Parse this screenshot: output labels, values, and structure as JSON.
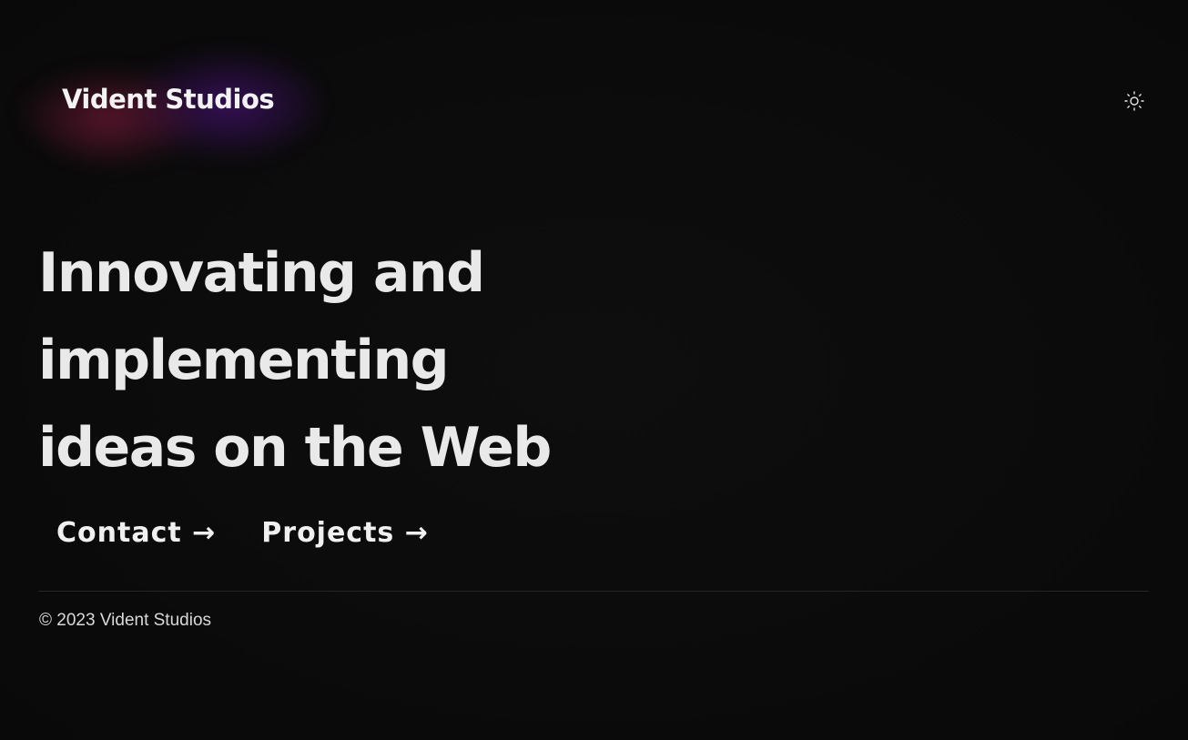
{
  "header": {
    "logo": "Vident Studios",
    "theme_toggle_icon": "sun-icon"
  },
  "hero": {
    "line1": "Innovating and implementing",
    "line2": "ideas on the Web"
  },
  "links": {
    "contact": "Contact →",
    "projects": "Projects →"
  },
  "footer": {
    "copyright": "© 2023 Vident Studios"
  },
  "colors": {
    "background": "#0b0b0b",
    "text": "#e9e9e9",
    "glow_pink": "#962a46",
    "glow_purple": "#5a1496"
  }
}
